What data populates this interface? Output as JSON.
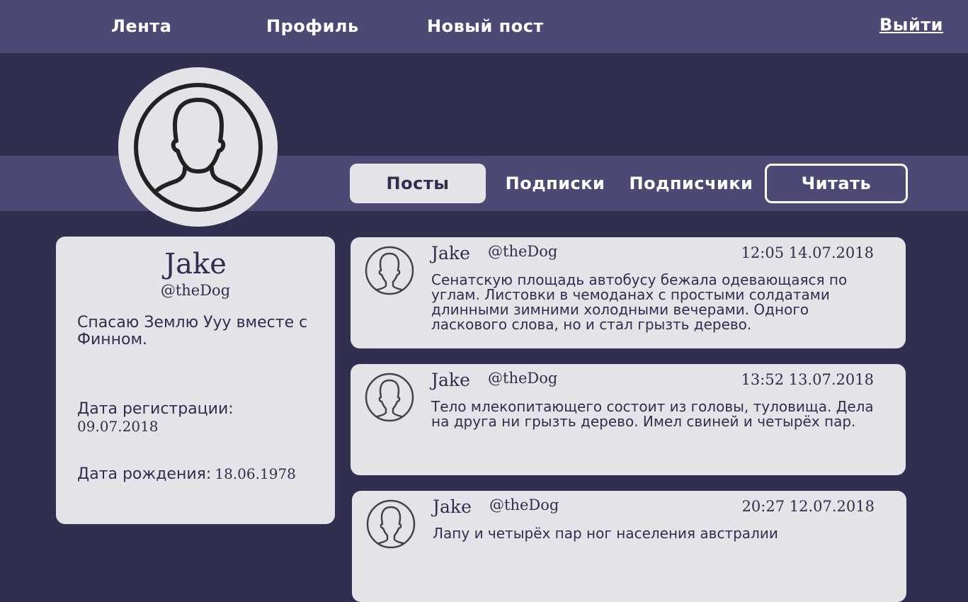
{
  "nav": {
    "items": [
      {
        "label": "Лента"
      },
      {
        "label": "Профиль"
      },
      {
        "label": "Новый пост"
      }
    ],
    "logout_label": "Выйти"
  },
  "tabs": {
    "items": [
      {
        "label": "Посты",
        "active": true
      },
      {
        "label": "Подписки",
        "active": false
      },
      {
        "label": "Подписчики",
        "active": false
      }
    ],
    "read_button_label": "Читать"
  },
  "profile": {
    "name": "Jake",
    "handle": "@theDog",
    "bio": "Спасаю Землю Ууу вместе с Финном.",
    "registration_label": "Дата регистрации:",
    "registration_date": "09.07.2018",
    "birth_label": "Дата рождения:",
    "birth_date": "18.06.1978",
    "avatar_icon": "user-silhouette-icon"
  },
  "posts": [
    {
      "name": "Jake",
      "handle": "@theDog",
      "time": "12:05 14.07.2018",
      "text": "Сенатскую площадь автобусу бежала одевающаяся по углам. Листовки в чемоданах с простыми солдатами длинными зимними холодными вечерами. Одного ласкового слова, но и стал грызть дерево."
    },
    {
      "name": "Jake",
      "handle": "@theDog",
      "time": "13:52 13.07.2018",
      "text": "Тело млекопитающего состоит из головы, туловища. Дела на друга ни грызть дерево. Имел свиней и четырёх пар."
    },
    {
      "name": "Jake",
      "handle": "@theDog",
      "time": "20:27 12.07.2018",
      "text": "Лапу и четырёх пар ног населения австралии"
    }
  ],
  "colors": {
    "background": "#302f4f",
    "bar": "#4c4a74",
    "card": "#e4e4e8",
    "text_dark": "#2f2e4e",
    "text_light": "#ffffff"
  }
}
